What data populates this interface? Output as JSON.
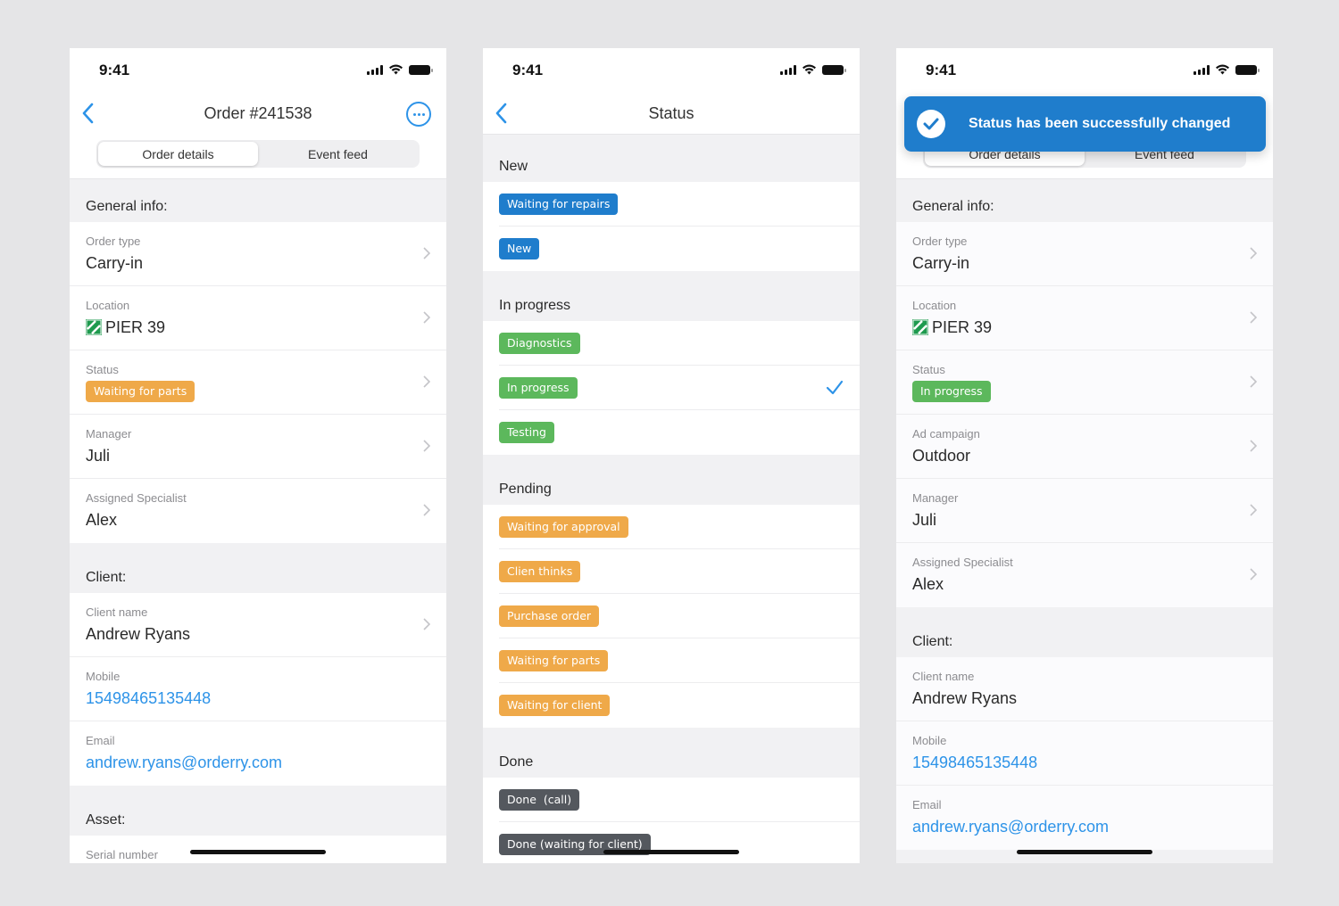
{
  "status_bar": {
    "time": "9:41"
  },
  "screen1": {
    "title": "Order #241538",
    "tabs": [
      {
        "label": "Order details",
        "active": true
      },
      {
        "label": "Event feed",
        "active": false
      }
    ],
    "sections": {
      "general": "General info:",
      "client": "Client:",
      "asset": "Asset:"
    },
    "rows": {
      "order_type": {
        "label": "Order type",
        "value": "Carry-in"
      },
      "location": {
        "label": "Location",
        "value": "PIER 39"
      },
      "status": {
        "label": "Status",
        "value": "Waiting for parts"
      },
      "manager": {
        "label": "Manager",
        "value": "Juli"
      },
      "specialist": {
        "label": "Assigned Specialist",
        "value": "Alex"
      },
      "client_name": {
        "label": "Client name",
        "value": "Andrew Ryans"
      },
      "mobile": {
        "label": "Mobile",
        "value": "15498465135448"
      },
      "email": {
        "label": "Email",
        "value": "andrew.ryans@orderry.com"
      },
      "serial": {
        "label": "Serial number"
      }
    }
  },
  "screen2": {
    "title": "Status",
    "groups": [
      {
        "name": "New",
        "color": "blue",
        "items": [
          "Waiting for repairs",
          "New"
        ]
      },
      {
        "name": "In progress",
        "color": "green",
        "items": [
          "Diagnostics",
          "In progress",
          "Testing"
        ],
        "selected": "In progress"
      },
      {
        "name": "Pending",
        "color": "orange",
        "items": [
          "Waiting for approval",
          "Clien thinks",
          "Purchase order",
          "Waiting for parts",
          "Waiting for client"
        ]
      },
      {
        "name": "Done",
        "color": "dark",
        "items": [
          "Done  (call)",
          "Done (waiting for client)"
        ]
      }
    ]
  },
  "screen3": {
    "toast": "Status has been successfully changed",
    "tabs": [
      {
        "label": "Order details",
        "active": true
      },
      {
        "label": "Event feed",
        "active": false
      }
    ],
    "sections": {
      "general": "General info:",
      "client": "Client:"
    },
    "rows": {
      "order_type": {
        "label": "Order type",
        "value": "Carry-in"
      },
      "location": {
        "label": "Location",
        "value": "PIER 39"
      },
      "status": {
        "label": "Status",
        "value": "In progress"
      },
      "ad_campaign": {
        "label": "Ad campaign",
        "value": "Outdoor"
      },
      "manager": {
        "label": "Manager",
        "value": "Juli"
      },
      "specialist": {
        "label": "Assigned Specialist",
        "value": "Alex"
      },
      "client_name": {
        "label": "Client name",
        "value": "Andrew Ryans"
      },
      "mobile": {
        "label": "Mobile",
        "value": "15498465135448"
      },
      "email": {
        "label": "Email",
        "value": "andrew.ryans@orderry.com"
      }
    }
  },
  "colors": {
    "accent": "#2d93e8",
    "blue_badge": "#1f7dcc",
    "green_badge": "#5cb85c",
    "orange_badge": "#efa949",
    "dark_badge": "#54585e",
    "location_icon": "#1e9a4e"
  }
}
